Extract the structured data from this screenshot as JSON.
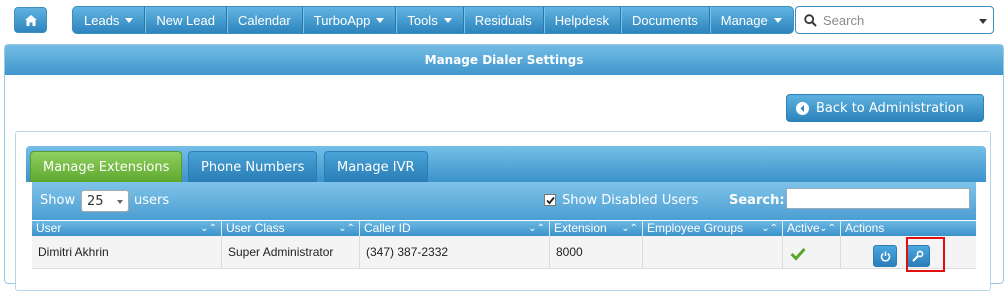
{
  "nav": {
    "home_icon": "home-icon",
    "items": [
      {
        "label": "Leads",
        "dropdown": true
      },
      {
        "label": "New Lead",
        "dropdown": false
      },
      {
        "label": "Calendar",
        "dropdown": false
      },
      {
        "label": "TurboApp",
        "dropdown": true
      },
      {
        "label": "Tools",
        "dropdown": true
      },
      {
        "label": "Residuals",
        "dropdown": false
      },
      {
        "label": "Helpdesk",
        "dropdown": false
      },
      {
        "label": "Documents",
        "dropdown": false
      },
      {
        "label": "Manage",
        "dropdown": true
      }
    ],
    "search_placeholder": "Search"
  },
  "panel": {
    "title": "Manage Dialer Settings",
    "back_button": "Back to Administration"
  },
  "tabs": [
    {
      "label": "Manage Extensions",
      "active": true
    },
    {
      "label": "Phone Numbers",
      "active": false
    },
    {
      "label": "Manage IVR",
      "active": false
    }
  ],
  "toolbar": {
    "show_label": "Show",
    "page_size": "25",
    "users_label": "users",
    "show_disabled_label": "Show Disabled Users",
    "show_disabled_checked": true,
    "search_label": "Search:",
    "search_value": ""
  },
  "table": {
    "columns": [
      "User",
      "User Class",
      "Caller ID",
      "Extension",
      "Employee Groups",
      "Active",
      "Actions"
    ],
    "rows": [
      {
        "user": "Dimitri Akhrin",
        "user_class": "Super Administrator",
        "caller_id": "(347) 387-2332",
        "extension": "8000",
        "employee_groups": "",
        "active": true
      }
    ]
  },
  "colors": {
    "accent": "#3f96cc",
    "active_tab": "#6bb23a",
    "highlight": "#e01010",
    "check": "#5aa62a"
  }
}
